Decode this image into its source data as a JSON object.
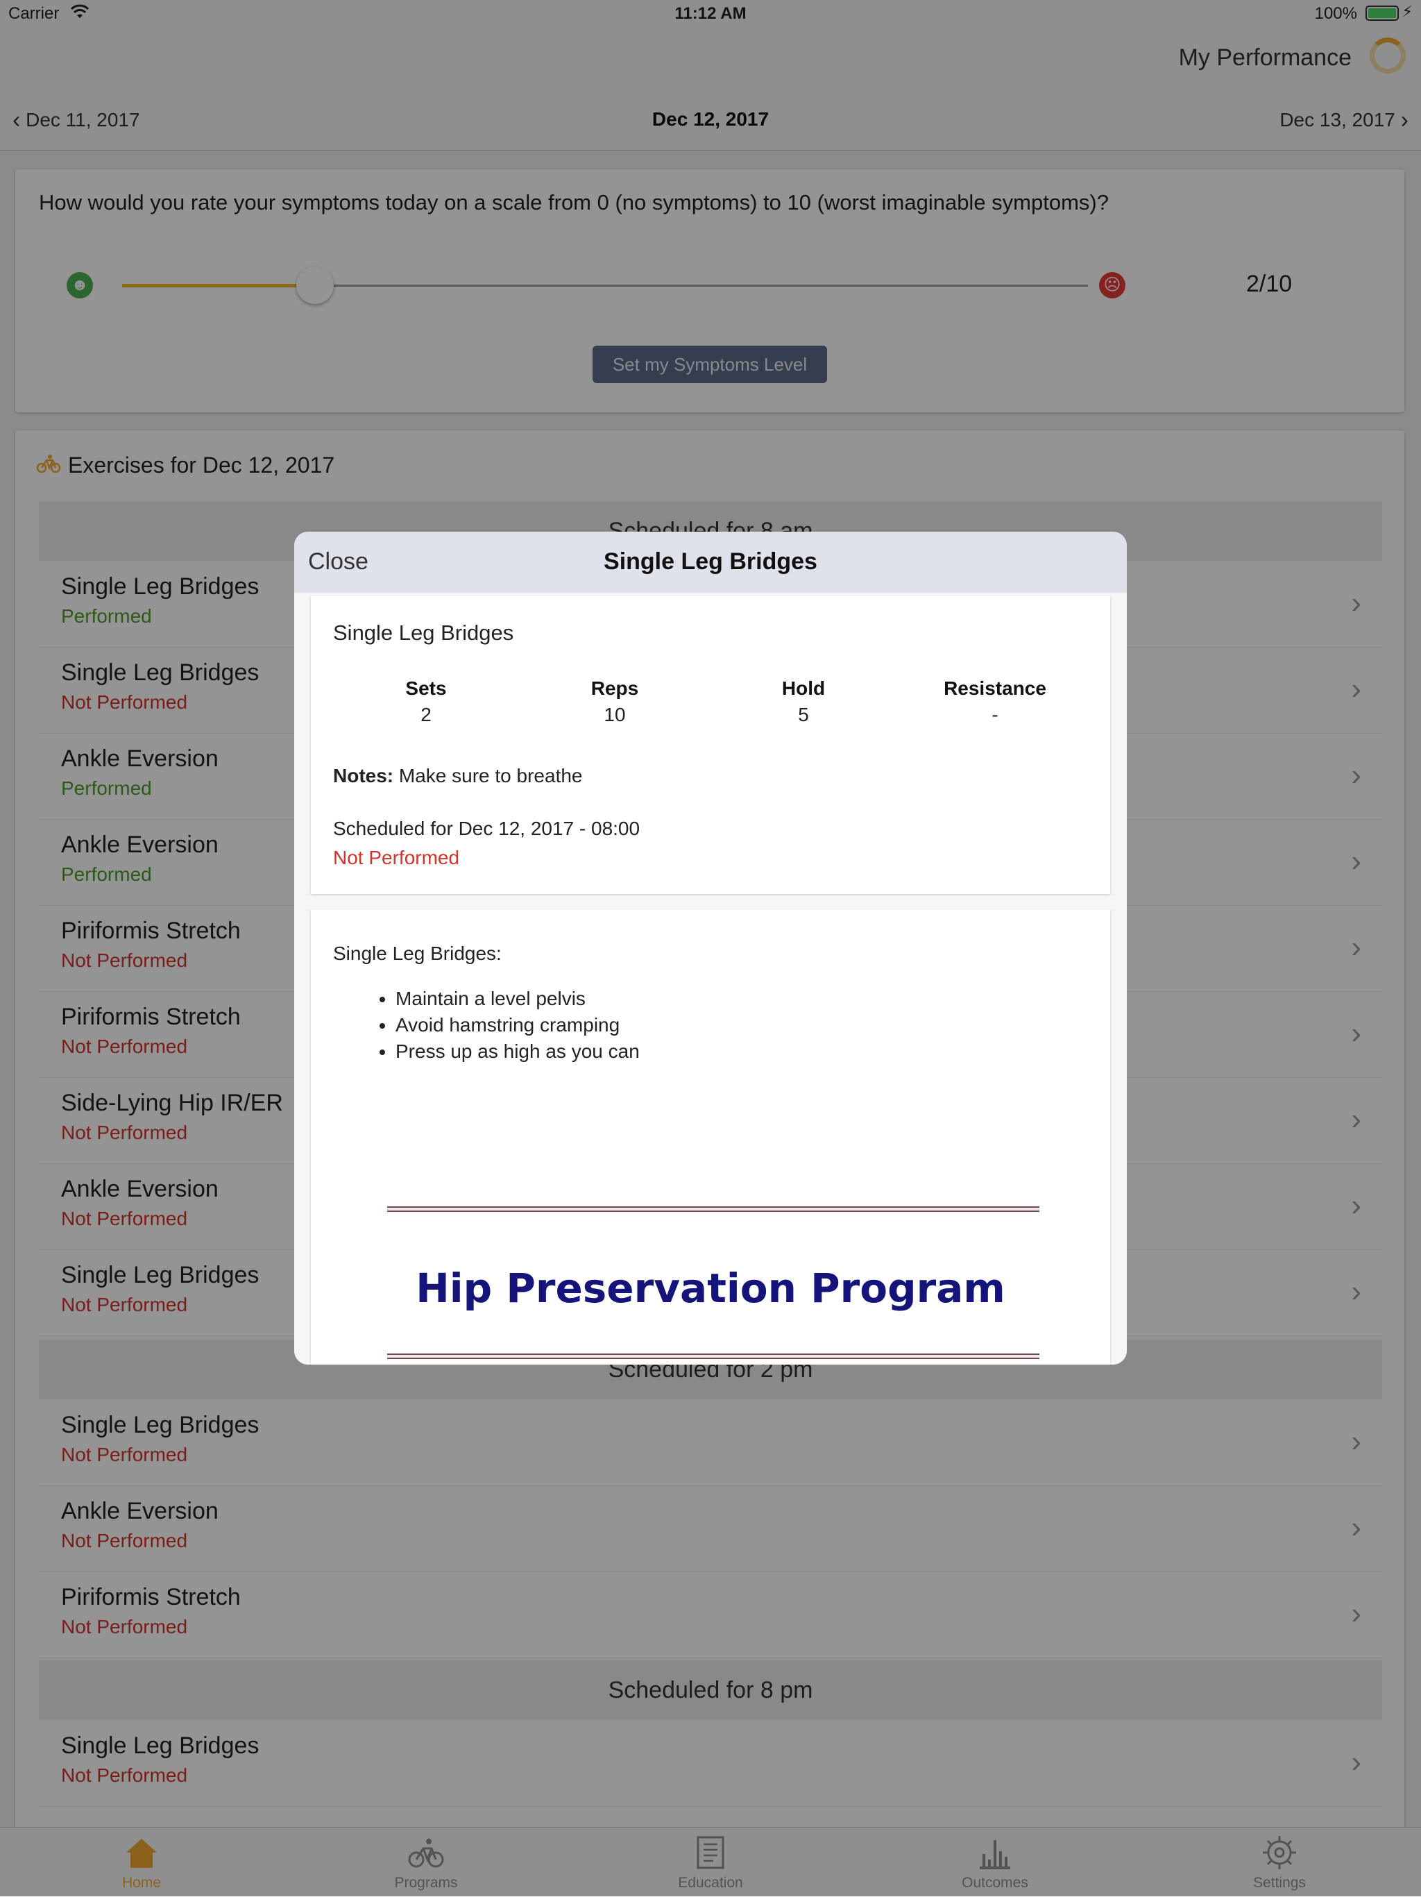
{
  "status_bar": {
    "carrier": "Carrier",
    "time": "11:12 AM",
    "battery": "100%"
  },
  "header": {
    "performance_label": "My Performance",
    "prev_date": "Dec 11, 2017",
    "current_date": "Dec 12, 2017",
    "next_date": "Dec 13, 2017"
  },
  "symptoms": {
    "question": "How would you rate your symptoms today on a scale from 0 (no symptoms) to 10 (worst imaginable symptoms)?",
    "level": 2,
    "max": 10,
    "score_text": "2/10",
    "button_label": "Set my Symptoms Level",
    "accent_color": "#f0b429"
  },
  "exercises": {
    "title": "Exercises for Dec 12, 2017",
    "groups": [
      {
        "label": "Scheduled for 8 am"
      },
      {
        "label": "Scheduled for 2 pm"
      },
      {
        "label": "Scheduled for 8 pm"
      }
    ],
    "rows": [
      {
        "name": "Single Leg Bridges",
        "status": "Performed"
      },
      {
        "name": "Single Leg Bridges",
        "status": "Not Performed"
      },
      {
        "name": "Ankle Eversion",
        "status": "Performed"
      },
      {
        "name": "Ankle Eversion",
        "status": "Performed"
      },
      {
        "name": "Piriformis Stretch",
        "status": "Not Performed"
      },
      {
        "name": "Piriformis Stretch",
        "status": "Not Performed"
      },
      {
        "name": "Side-Lying Hip IR/ER",
        "status": "Not Performed"
      },
      {
        "name": "Ankle Eversion",
        "status": "Not Performed"
      },
      {
        "name": "Single Leg Bridges",
        "status": "Not Performed"
      },
      {
        "name": "Single Leg Bridges",
        "status": "Not Performed"
      },
      {
        "name": "Ankle Eversion",
        "status": "Not Performed"
      },
      {
        "name": "Piriformis Stretch",
        "status": "Not Performed"
      },
      {
        "name": "Single Leg Bridges",
        "status": "Not Performed"
      }
    ]
  },
  "modal": {
    "close_label": "Close",
    "title": "Single Leg Bridges",
    "exercise_name": "Single Leg Bridges",
    "stats": [
      {
        "label": "Sets",
        "value": "2"
      },
      {
        "label": "Reps",
        "value": "10"
      },
      {
        "label": "Hold",
        "value": "5"
      },
      {
        "label": "Resistance",
        "value": "-"
      }
    ],
    "notes_label": "Notes:",
    "notes_text": "Make sure to breathe",
    "scheduled": "Scheduled for Dec 12, 2017 - 08:00",
    "status": "Not Performed",
    "description_title": "Single Leg Bridges:",
    "bullets": [
      "Maintain a level pelvis",
      "Avoid hamstring cramping",
      "Press up as high as you can"
    ],
    "program_title": "Hip Preservation Program"
  },
  "tabs": [
    {
      "label": "Home",
      "icon": "home-icon",
      "active": true
    },
    {
      "label": "Programs",
      "icon": "bicycle-icon",
      "active": false
    },
    {
      "label": "Education",
      "icon": "book-icon",
      "active": false
    },
    {
      "label": "Outcomes",
      "icon": "bar-chart-icon",
      "active": false
    },
    {
      "label": "Settings",
      "icon": "gear-icon",
      "active": false
    }
  ]
}
